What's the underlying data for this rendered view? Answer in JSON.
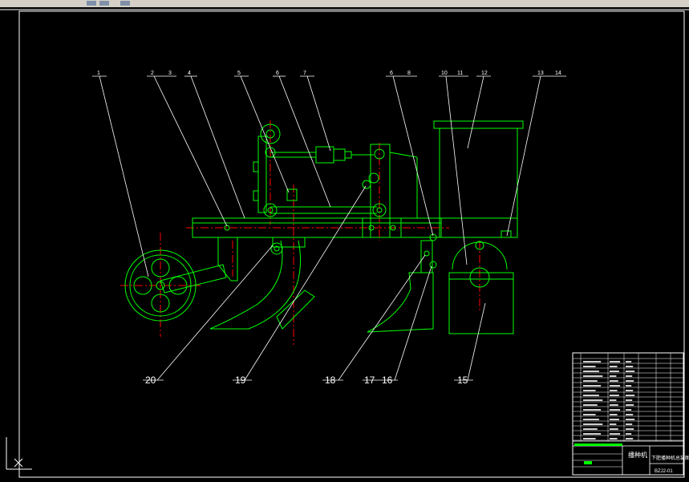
{
  "drawing": {
    "colors": {
      "background": "#000000",
      "outline": "#00ff00",
      "leader": "#ffffff",
      "center_line": "#ff0000",
      "border": "#ffffff"
    },
    "top_labels": [
      "1",
      "2",
      "3",
      "4",
      "5",
      "6",
      "7",
      "6",
      "8",
      "10",
      "11",
      "12",
      "13",
      "14"
    ],
    "bottom_labels": [
      "20",
      "19",
      "18",
      "17",
      "16",
      "15"
    ],
    "title_block": {
      "name": "播种机",
      "subtitle": "下肥播种机总装图",
      "code": "BZJ2-01"
    }
  }
}
